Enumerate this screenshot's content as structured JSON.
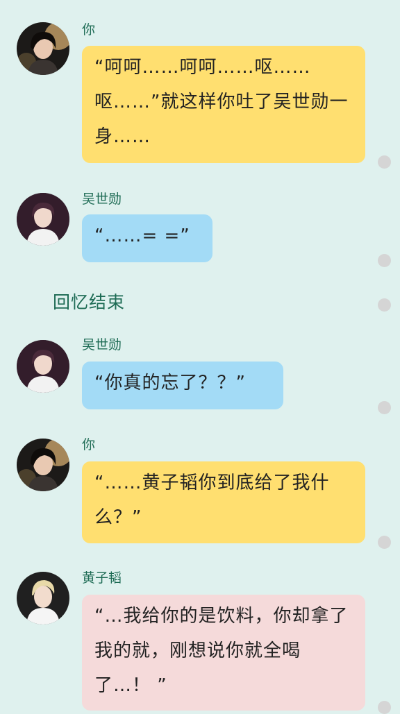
{
  "messages": [
    {
      "sender": "你",
      "avatar": "female-avatar",
      "bubble_color": "#ffdf70",
      "text": "“呵呵……呵呵……呕……呕……”就这样你吐了吴世勋一身……"
    },
    {
      "sender": "吴世勋",
      "avatar": "male-avatar-dark-hair",
      "bubble_color": "#a3dbf6",
      "text": "“……= =”"
    },
    {
      "sender": "吴世勋",
      "avatar": "male-avatar-dark-hair",
      "bubble_color": "#a3dbf6",
      "text": "“你真的忘了？？”"
    },
    {
      "sender": "你",
      "avatar": "female-avatar",
      "bubble_color": "#ffdf70",
      "text": "“……黄子韬你到底给了我什么？”"
    },
    {
      "sender": "黄子韬",
      "avatar": "male-avatar-blond-hair",
      "bubble_color": "#f5dada",
      "text": "“…我给你的是饮料，你却拿了我的就，刚想说你就全喝了…！ ”"
    }
  ],
  "system_note": "回忆结束",
  "colors": {
    "background": "#dff1ee",
    "name_text": "#1d6b54",
    "dot": "#d5d5d5"
  }
}
